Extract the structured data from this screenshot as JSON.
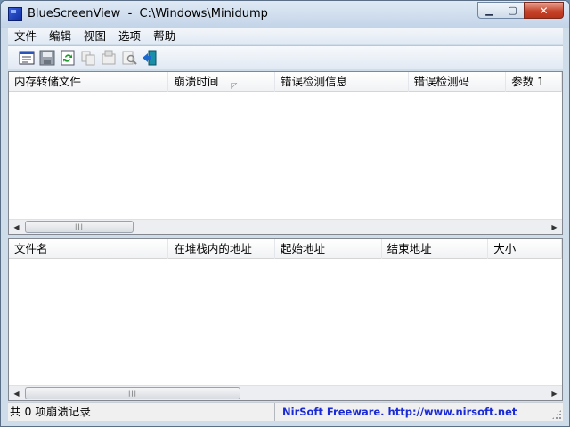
{
  "window": {
    "title": "BlueScreenView  -  C:\\Windows\\Minidump",
    "minimize": "▁",
    "maximize": "▢",
    "close": "✕"
  },
  "menu": [
    "文件",
    "编辑",
    "视图",
    "选项",
    "帮助"
  ],
  "toolbar": {
    "icons": [
      "properties-icon",
      "save-icon",
      "refresh-icon",
      "copy-icon",
      "html-report-icon",
      "find-icon",
      "exit-icon"
    ]
  },
  "upper_list": {
    "columns": [
      "内存转储文件",
      "崩溃时间",
      "错误检测信息",
      "错误检测码",
      "参数 1"
    ],
    "sort_indicator": "◸",
    "rows": []
  },
  "lower_list": {
    "columns": [
      "文件名",
      "在堆栈内的地址",
      "起始地址",
      "结束地址",
      "大小"
    ],
    "rows": []
  },
  "scrollbar": {
    "left": "◀",
    "right": "▶",
    "grip": "|||"
  },
  "status": {
    "count": "共 0 项崩溃记录",
    "credit": "NirSoft Freeware.  http://www.nirsoft.net"
  }
}
